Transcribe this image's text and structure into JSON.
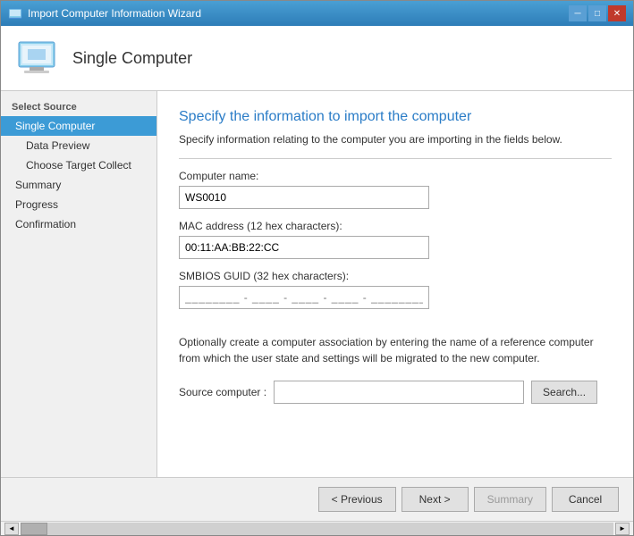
{
  "window": {
    "title": "Import Computer Information Wizard",
    "header": {
      "icon_alt": "computer-icon",
      "title": "Single Computer"
    }
  },
  "sidebar": {
    "section_label": "Select Source",
    "items": [
      {
        "id": "single-computer",
        "label": "Single Computer",
        "active": true,
        "sub": false
      },
      {
        "id": "data-preview",
        "label": "Data Preview",
        "active": false,
        "sub": true
      },
      {
        "id": "choose-target",
        "label": "Choose Target Collect",
        "active": false,
        "sub": true
      },
      {
        "id": "summary",
        "label": "Summary",
        "active": false,
        "sub": false
      },
      {
        "id": "progress",
        "label": "Progress",
        "active": false,
        "sub": false
      },
      {
        "id": "confirmation",
        "label": "Confirmation",
        "active": false,
        "sub": false
      }
    ]
  },
  "main": {
    "title": "Specify the information to import the computer",
    "description": "Specify information relating to the computer you are importing in the fields below.",
    "fields": {
      "computer_name_label": "Computer name:",
      "computer_name_value": "WS0010",
      "mac_address_label": "MAC address (12 hex characters):",
      "mac_address_value": "00:11:AA:BB:22:CC",
      "smbios_label": "SMBIOS GUID (32 hex characters):",
      "smbios_value": "___ - ___ - ___ - ___ - ___"
    },
    "association": {
      "description": "Optionally create a computer association by entering the name of a reference computer from which the user state and settings will be migrated to the new computer.",
      "source_label": "Source computer :",
      "source_value": "",
      "search_button": "Search..."
    }
  },
  "footer": {
    "previous_label": "< Previous",
    "next_label": "Next >",
    "summary_label": "Summary",
    "cancel_label": "Cancel"
  },
  "scrollbar": {
    "left_arrow": "◄",
    "right_arrow": "►"
  }
}
